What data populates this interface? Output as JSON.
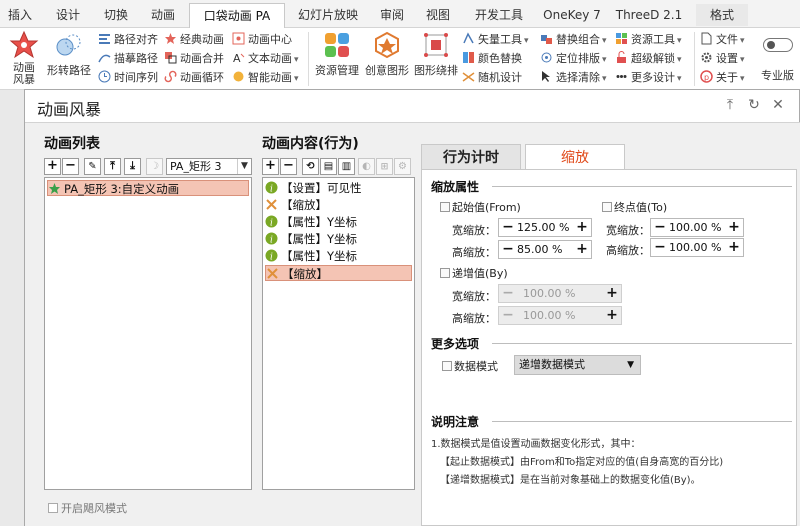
{
  "ribbon_tabs": [
    "插入",
    "设计",
    "切换",
    "动画",
    "口袋动画 PA",
    "幻灯片放映",
    "审阅",
    "视图",
    "开发工具",
    "OneKey 7",
    "ThreeD 2.1",
    "格式"
  ],
  "ribbon": {
    "anim_storm_label": "动画风暴",
    "shape_path_label": "形转路径",
    "path_align": "路径对齐",
    "trace_path": "描摹路径",
    "time_sequence": "时间序列",
    "classic_anim": "经典动画",
    "anim_merge": "动画合并",
    "anim_loop": "动画循环",
    "anim_center": "动画中心",
    "text_anim": "文本动画",
    "smart_anim": "智能动画",
    "resource_mgmt": "资源管理",
    "creative_shape": "创意图形",
    "shape_layout": "图形绕排",
    "vector_tool": "矢量工具",
    "color_replace": "颜色替换",
    "random_design": "随机设计",
    "replace_group": "替换组合",
    "locate_layout": "定位排版",
    "select_clear": "选择清除",
    "resource_tool": "资源工具",
    "super_unlock": "超级解锁",
    "more_design": "更多设计",
    "file": "文件",
    "settings": "设置",
    "about": "关于",
    "pro_version": "专业版"
  },
  "dialog": {
    "title": "动画风暴",
    "anim_list_title": "动画列表",
    "anim_content_title": "动画内容(行为)",
    "shape_combo": "PA_矩形 3",
    "list_items": [
      "PA_矩形 3:自定义动画"
    ],
    "content_items": [
      "【设置】可见性",
      "【缩放】",
      "【属性】Y坐标",
      "【属性】Y坐标",
      "【属性】Y坐标",
      "【缩放】"
    ],
    "storm_mode_label": "开启飓风模式",
    "tab_timing": "行为计时",
    "tab_scale": "缩放",
    "scale_props": "缩放属性",
    "from_label": "起始值(From)",
    "to_label": "终点值(To)",
    "by_label": "递增值(By)",
    "width_scale": "宽缩放：",
    "height_scale": "高缩放：",
    "from_width": "125.00 %",
    "from_height": "85.00 %",
    "to_width": "100.00 %",
    "to_height": "100.00 %",
    "by_width": "100.00 %",
    "by_height": "100.00 %",
    "more_options": "更多选项",
    "data_mode_label": "数据模式",
    "data_mode_value": "递增数据模式",
    "notes_title": "说明注意",
    "note_lines": [
      "1.数据模式是值设置动画数据变化形式，其中：",
      "【起止数据模式】由From和To指定对应的值(自身高宽的百分比)",
      "【递增数据模式】是在当前对象基础上的数据变化值(By)。"
    ]
  },
  "colors": {
    "accent": "#e04a1a",
    "selection": "#f4c4b4"
  }
}
